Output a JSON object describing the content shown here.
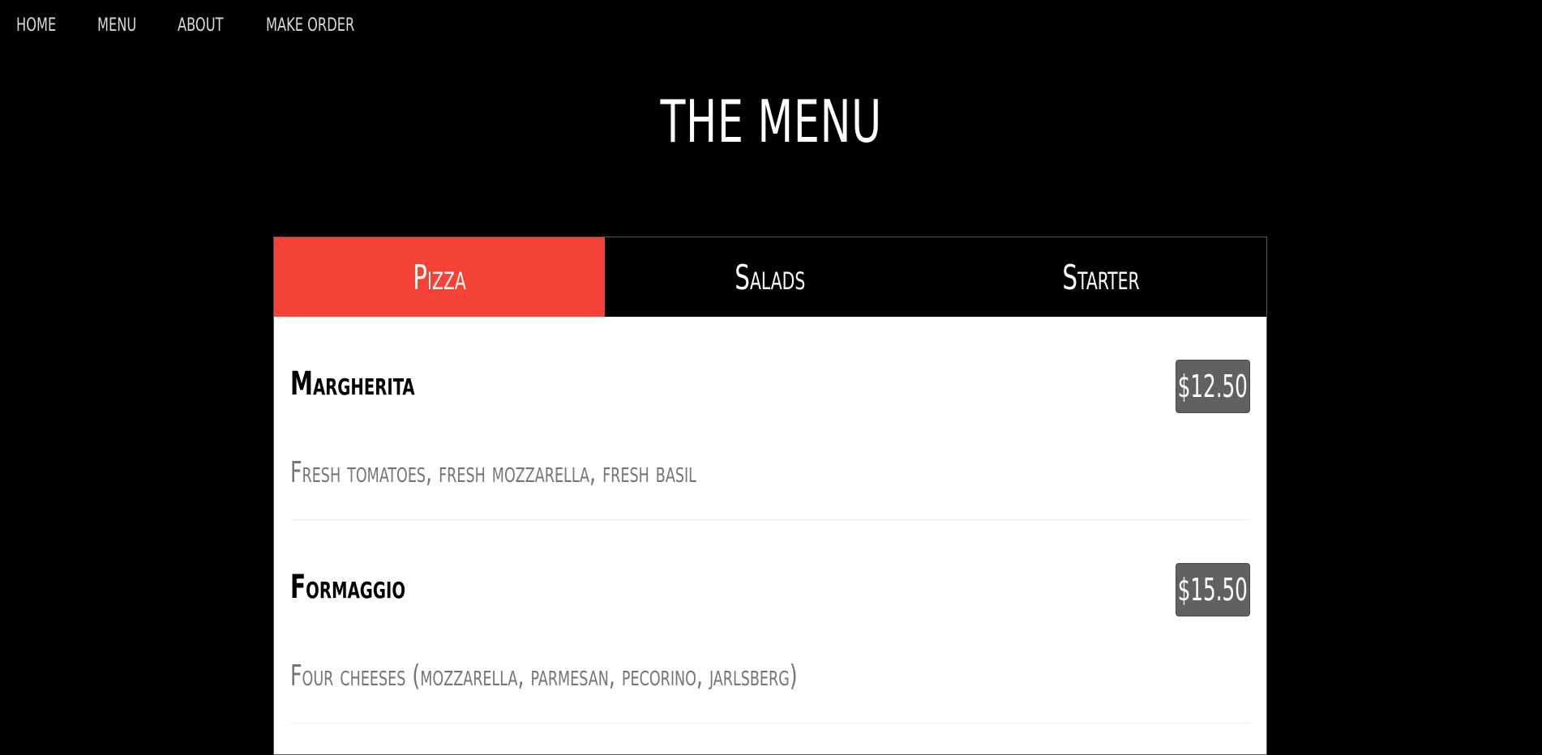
{
  "nav": {
    "items": [
      {
        "label": "HOME"
      },
      {
        "label": "MENU"
      },
      {
        "label": "ABOUT"
      },
      {
        "label": "MAKE ORDER"
      }
    ]
  },
  "page": {
    "title": "THE MENU"
  },
  "tabs": {
    "items": [
      {
        "label": "Pizza",
        "active": true
      },
      {
        "label": "Salads",
        "active": false
      },
      {
        "label": "Starter",
        "active": false
      }
    ],
    "active_color": "#f44336"
  },
  "menu": {
    "items": [
      {
        "name": "Margherita",
        "price": "$12.50",
        "description": "Fresh tomatoes, fresh mozzarella, fresh basil"
      },
      {
        "name": "Formaggio",
        "price": "$15.50",
        "description": "Four cheeses (mozzarella, parmesan, pecorino, jarlsberg)"
      }
    ]
  }
}
